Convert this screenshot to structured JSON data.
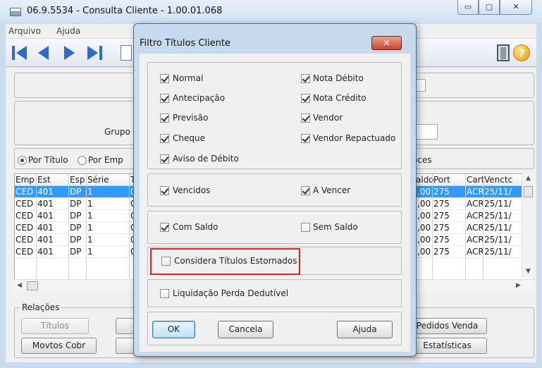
{
  "window": {
    "title": "06.9.5534 - Consulta Cliente - 1.00.01.068",
    "min_glyph": "▭",
    "max_glyph": "▢",
    "close_glyph": "✕"
  },
  "menu": {
    "items": [
      "Arquivo",
      "Ajuda"
    ]
  },
  "toolbar": {
    "icons": [
      "first-record-icon",
      "previous-record-icon",
      "next-record-icon",
      "last-record-icon",
      "new-document-icon",
      "exit-door-icon",
      "help-icon"
    ],
    "help_glyph": "?"
  },
  "main": {
    "grupo_label": "Grupo",
    "radio_options": [
      "Por Título",
      "Por Emp"
    ],
    "radio_selected": "Por Título",
    "right_option_fragment": "oces",
    "grid": {
      "left_columns": [
        "Emp",
        "Est",
        "Esp",
        "Série",
        "T"
      ],
      "right_columns": [
        "aldo",
        "Port",
        "Cart",
        "Venctc"
      ],
      "rows": [
        {
          "emp": "CED",
          "est": "401",
          "esp": "DP",
          "serie": "1",
          "t": "0(",
          "saldo": ",00",
          "port": "275",
          "cart": "ACR",
          "venc": "25/11/"
        },
        {
          "emp": "CED",
          "est": "401",
          "esp": "DP",
          "serie": "1",
          "t": "0(",
          "saldo": ",00",
          "port": "275",
          "cart": "ACR",
          "venc": "25/11/"
        },
        {
          "emp": "CED",
          "est": "401",
          "esp": "DP",
          "serie": "1",
          "t": "0(",
          "saldo": ",00",
          "port": "275",
          "cart": "ACR",
          "venc": "25/11/"
        },
        {
          "emp": "CED",
          "est": "401",
          "esp": "DP",
          "serie": "1",
          "t": "0(",
          "saldo": ",00",
          "port": "275",
          "cart": "ACR",
          "venc": "25/11/"
        },
        {
          "emp": "CED",
          "est": "401",
          "esp": "DP",
          "serie": "1",
          "t": "0(",
          "saldo": ",00",
          "port": "275",
          "cart": "ACR",
          "venc": "25/11/"
        },
        {
          "emp": "CED",
          "est": "401",
          "esp": "DP",
          "serie": "1",
          "t": "0(",
          "saldo": ",00",
          "port": "275",
          "cart": "ACR",
          "venc": "25/11/"
        }
      ]
    },
    "relacoes_label": "Relações",
    "buttons": {
      "titulos": "Títulos",
      "movtos_cobr": "Movtos Cobr",
      "pedidos_venda": "Pedidos Venda",
      "estatisticas": "Estatísticas"
    }
  },
  "dialog": {
    "title": "Filtro Títulos Cliente",
    "close_glyph": "✕",
    "checkboxes": {
      "normal": {
        "label": "Normal",
        "checked": true
      },
      "antecipacao": {
        "label": "Antecipação",
        "checked": true
      },
      "previsao": {
        "label": "Previsão",
        "checked": true
      },
      "cheque": {
        "label": "Cheque",
        "checked": true
      },
      "aviso_debito": {
        "label": "Aviso de Débito",
        "checked": true
      },
      "nota_debito": {
        "label": "Nota Débito",
        "checked": true
      },
      "nota_credito": {
        "label": "Nota Crédito",
        "checked": true
      },
      "vendor": {
        "label": "Vendor",
        "checked": true
      },
      "vendor_repactuado": {
        "label": "Vendor Repactuado",
        "checked": true
      },
      "vencidos": {
        "label": "Vencidos",
        "checked": true
      },
      "a_vencer": {
        "label": "A Vencer",
        "checked": true
      },
      "com_saldo": {
        "label": "Com Saldo",
        "checked": true
      },
      "sem_saldo": {
        "label": "Sem Saldo",
        "checked": false
      },
      "considera_estornados": {
        "label": "Considera Títulos Estornados",
        "checked": false
      },
      "liquidacao_perda": {
        "label": "Liquidação Perda Dedutível",
        "checked": false
      }
    },
    "buttons": {
      "ok": "OK",
      "cancela": "Cancela",
      "ajuda": "Ajuda"
    },
    "highlight_color": "#d9222a"
  }
}
